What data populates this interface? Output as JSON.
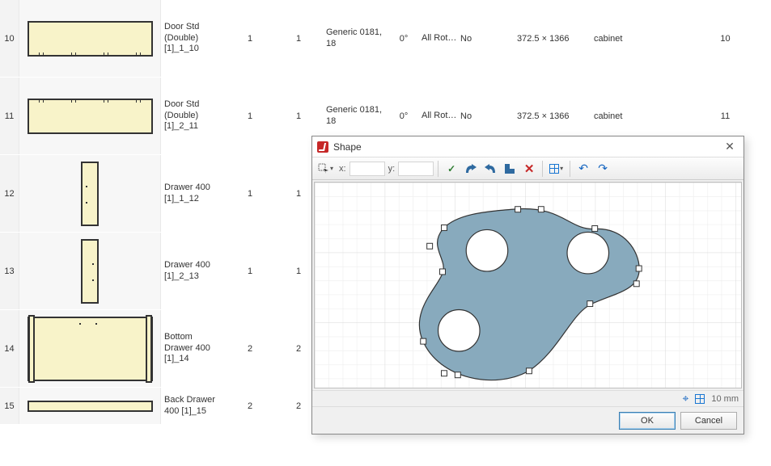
{
  "rows": [
    {
      "idx": "10",
      "name": "Door Std (Double) [1]_1_10",
      "q1": "1",
      "q2": "1",
      "mat": "Generic 0181, 18",
      "ang": "0°",
      "rot": "All Rotati...",
      "no": "No",
      "size": "372.5 × 1366",
      "cab": "cabinet",
      "idx2": "10",
      "shape": "door"
    },
    {
      "idx": "11",
      "name": "Door Std (Double) [1]_2_11",
      "q1": "1",
      "q2": "1",
      "mat": "Generic 0181, 18",
      "ang": "0°",
      "rot": "All Rotati...",
      "no": "No",
      "size": "372.5 × 1366",
      "cab": "cabinet",
      "idx2": "11",
      "shape": "door2"
    },
    {
      "idx": "12",
      "name": "Drawer 400 [1]_1_12",
      "q1": "1",
      "q2": "1",
      "shape": "drawer"
    },
    {
      "idx": "13",
      "name": "Drawer 400 [1]_2_13",
      "q1": "1",
      "q2": "1",
      "shape": "drawer"
    },
    {
      "idx": "14",
      "name": "Bottom Drawer 400 [1]_14",
      "q1": "2",
      "q2": "2",
      "shape": "bottom"
    },
    {
      "idx": "15",
      "name": "Back Drawer 400 [1]_15",
      "q1": "2",
      "q2": "2",
      "shape": "back"
    }
  ],
  "dialog": {
    "title": "Shape",
    "xlabel": "x:",
    "ylabel": "y:",
    "ok": "OK",
    "cancel": "Cancel",
    "gridsize": "10 mm",
    "crosshair_icon": "⌖"
  },
  "tool": {
    "menu_arrow": "▾",
    "check": "✓",
    "cross": "✕",
    "undo": "↶",
    "redo": "↷",
    "grid_arrow": "▾"
  }
}
